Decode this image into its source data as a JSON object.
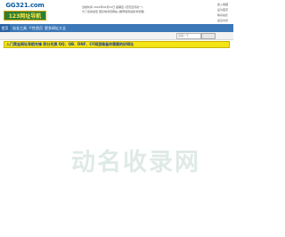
{
  "header": {
    "logo_top": "GG321.com",
    "logo_bottom": "123网址导航",
    "date_line": "当前时间 2020年04月23日 星期四 (农历四月初一)",
    "desc_line": "为了您的最佳 更好地浏览网站 (推荐使用最新浏览器)",
    "quick_links": [
      "加入收藏",
      "设为首页",
      "联系站长",
      "最近访问"
    ]
  },
  "nav": {
    "items": [
      "首页",
      "站长工具",
      "个性首页",
      "更多网址大全"
    ]
  },
  "subbar": {
    "search_placeholder": "百度一下"
  },
  "banner": {
    "text": "入门黄金网址导航先锋 积分兑换 QQ、QB、DNF、CF网游装备你需要的好网址"
  },
  "watermark": {
    "text": "动名收录网"
  },
  "colors": {
    "nav_bg": "#3c78b8",
    "banner_bg": "#f3e417",
    "logo_green": "#2c7d3a"
  }
}
